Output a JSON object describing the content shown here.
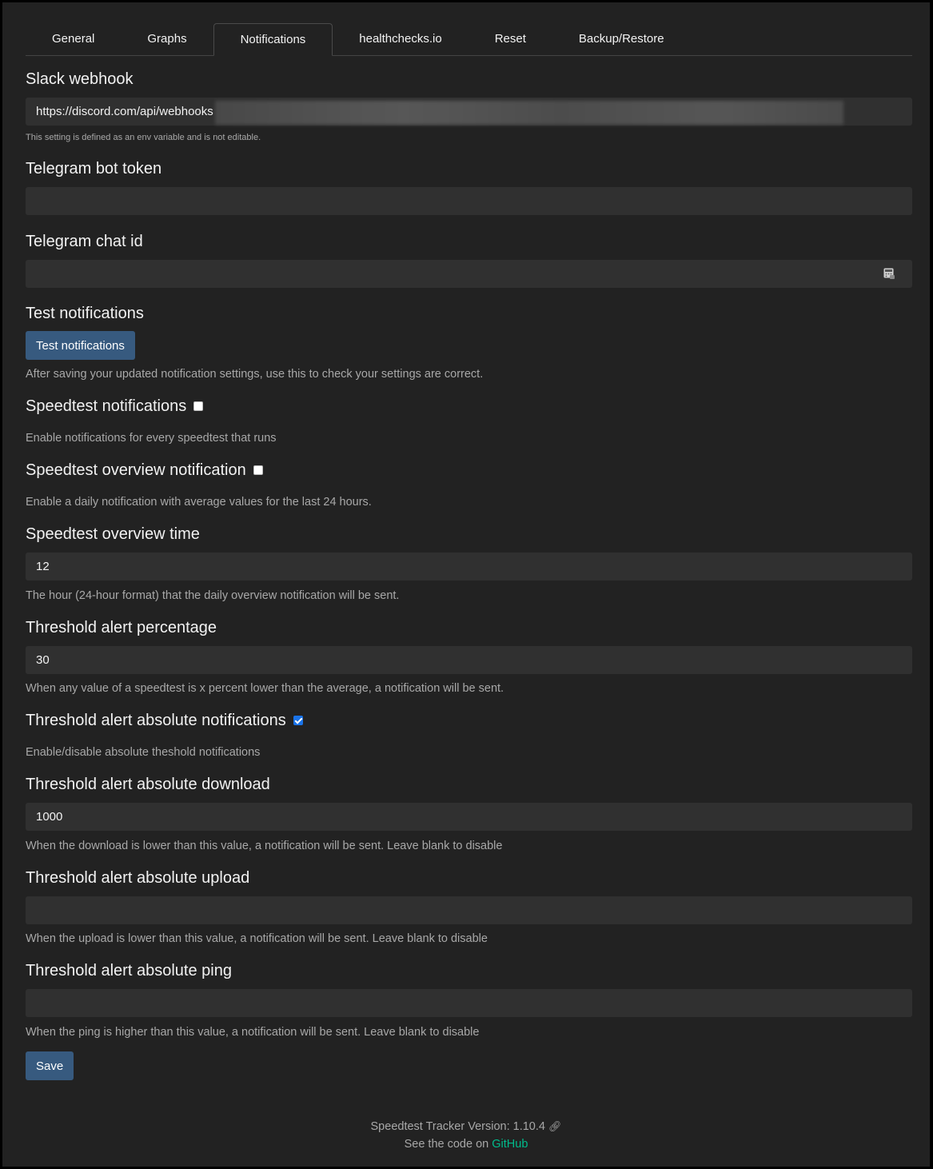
{
  "tabs": [
    {
      "label": "General"
    },
    {
      "label": "Graphs"
    },
    {
      "label": "Notifications"
    },
    {
      "label": "healthchecks.io"
    },
    {
      "label": "Reset"
    },
    {
      "label": "Backup/Restore"
    }
  ],
  "active_tab": "Notifications",
  "slack": {
    "label": "Slack webhook",
    "value": "https://discord.com/api/webhooks",
    "help": "This setting is defined as an env variable and is not editable."
  },
  "telegram_token": {
    "label": "Telegram bot token",
    "value": ""
  },
  "telegram_chat": {
    "label": "Telegram chat id",
    "value": ""
  },
  "test": {
    "label": "Test notifications",
    "button": "Test notifications",
    "help": "After saving your updated notification settings, use this to check your settings are correct."
  },
  "speedtest_notif": {
    "label": "Speedtest notifications",
    "checked": false,
    "help": "Enable notifications for every speedtest that runs"
  },
  "overview_notif": {
    "label": "Speedtest overview notification",
    "checked": false,
    "help": "Enable a daily notification with average values for the last 24 hours."
  },
  "overview_time": {
    "label": "Speedtest overview time",
    "value": "12",
    "help": "The hour (24-hour format) that the daily overview notification will be sent."
  },
  "threshold_pct": {
    "label": "Threshold alert percentage",
    "value": "30",
    "help": "When any value of a speedtest is x percent lower than the average, a notification will be sent."
  },
  "threshold_abs_notif": {
    "label": "Threshold alert absolute notifications",
    "checked": true,
    "help": "Enable/disable absolute theshold notifications"
  },
  "threshold_download": {
    "label": "Threshold alert absolute download",
    "value": "1000",
    "help": "When the download is lower than this value, a notification will be sent. Leave blank to disable"
  },
  "threshold_upload": {
    "label": "Threshold alert absolute upload",
    "value": "",
    "help": "When the upload is lower than this value, a notification will be sent. Leave blank to disable"
  },
  "threshold_ping": {
    "label": "Threshold alert absolute ping",
    "value": "",
    "help": "When the ping is higher than this value, a notification will be sent. Leave blank to disable"
  },
  "save_button": "Save",
  "footer": {
    "version": "Speedtest Tracker Version: 1.10.4",
    "code_prefix": "See the code on",
    "code_link": "GitHub"
  },
  "colors": {
    "background": "#222222",
    "input": "#303030",
    "button": "#375a7f",
    "link": "#00bc8c",
    "checkbox_checked": "#1a73e8"
  },
  "icons": [
    "calculator-icon",
    "link-icon"
  ]
}
